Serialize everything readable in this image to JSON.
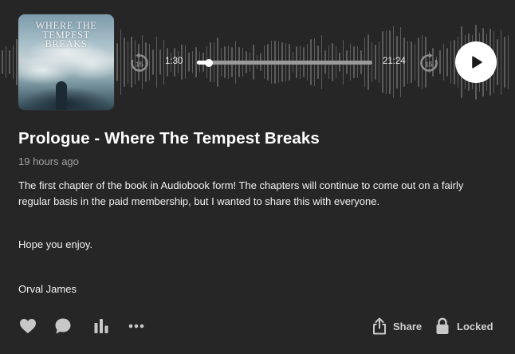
{
  "episode": {
    "cover_title_lines": [
      "WHERE THE",
      "TEMPEST",
      "BREAKS"
    ],
    "title": "Prologue - Where The Tempest Breaks",
    "posted": "19 hours ago",
    "description_1": "The first chapter of the book in Audiobook form! The chapters will continue to come out on a fairly regular basis in the paid membership, but I wanted to share this with everyone.",
    "description_2": "Hope you enjoy.",
    "description_3": "Orval James"
  },
  "player": {
    "current_time": "1:30",
    "total_time": "21:24",
    "progress_fraction": 0.07,
    "skip_back_seconds": "15",
    "skip_forward_seconds": "15"
  },
  "actions": {
    "share_label": "Share",
    "locked_label": "Locked"
  },
  "icons": {
    "skip_back": "rewind-15-icon",
    "skip_forward": "forward-15-icon",
    "play": "play-icon",
    "like": "heart-icon",
    "comment": "comment-bubble-icon",
    "stats": "bar-chart-icon",
    "more": "more-dots-icon",
    "share": "share-icon",
    "locked": "lock-icon"
  },
  "colors": {
    "background": "#262626",
    "text": "#ffffff",
    "muted_text": "#a3a3a3",
    "waveform": "#5c5c5c",
    "progress_track": "#9a9a9a"
  }
}
